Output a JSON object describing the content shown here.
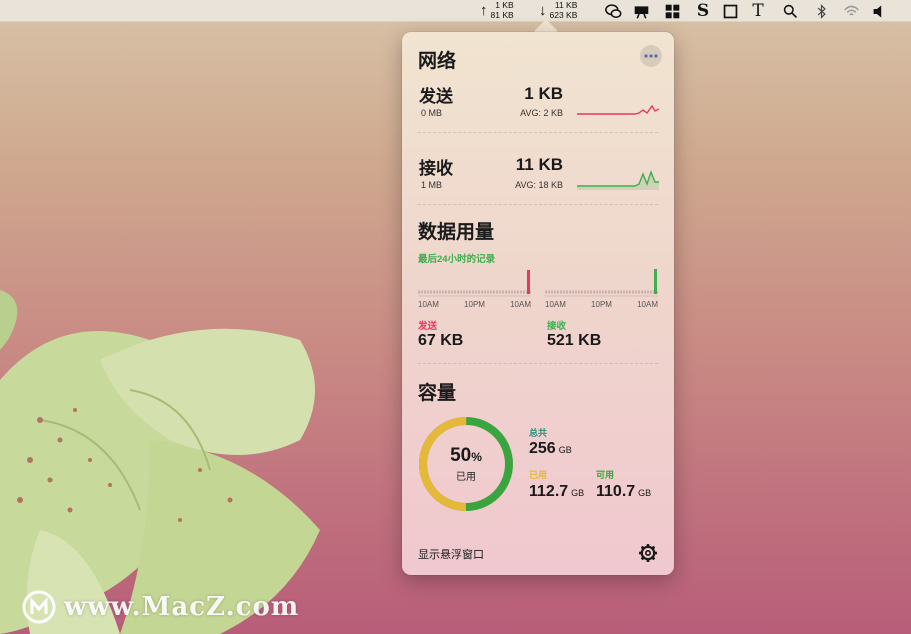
{
  "menubar": {
    "upload": {
      "arrow": "↑",
      "rate": "1 KB",
      "total": "81 KB"
    },
    "download": {
      "arrow": "↓",
      "rate": "11 KB",
      "total": "623 KB"
    },
    "icons": [
      "wechat-icon",
      "stats-icon",
      "windows-icon",
      "s-app-icon",
      "square-icon",
      "typeface-icon",
      "search-icon",
      "bluetooth-icon",
      "wifi-icon",
      "volume-icon"
    ],
    "text_glyphs": {
      "s_app": "S",
      "typeface": "T"
    }
  },
  "panel": {
    "network_title": "网络",
    "send": {
      "label": "发送",
      "total": "0 MB",
      "value": "1 KB",
      "avg": "AVG: 2 KB",
      "color": "#e8385e"
    },
    "receive": {
      "label": "接收",
      "total": "1 MB",
      "value": "11 KB",
      "avg": "AVG: 18 KB",
      "color": "#3fae4f"
    },
    "usage_title": "数据用量",
    "usage_caption": "最后24小时的记录",
    "axis_ticks": [
      "10AM",
      "10PM",
      "10AM"
    ],
    "usage_send": {
      "label": "发送",
      "value": "67 KB"
    },
    "usage_receive": {
      "label": "接收",
      "value": "521 KB"
    },
    "capacity_title": "容量",
    "capacity": {
      "used_percent": 50,
      "percent_number": "50",
      "percent_sign": "%",
      "ring_label": "已用",
      "total_label": "总共",
      "total_value": "256",
      "total_unit": "GB",
      "used_label": "已用",
      "used_value": "112.7",
      "used_unit": "GB",
      "free_label": "可用",
      "free_value": "110.7",
      "free_unit": "GB",
      "used_color": "#e6b83a",
      "free_color": "#3aa53f"
    },
    "footer_link": "显示悬浮窗口"
  },
  "watermark": {
    "text": "www.MacZ.com"
  }
}
